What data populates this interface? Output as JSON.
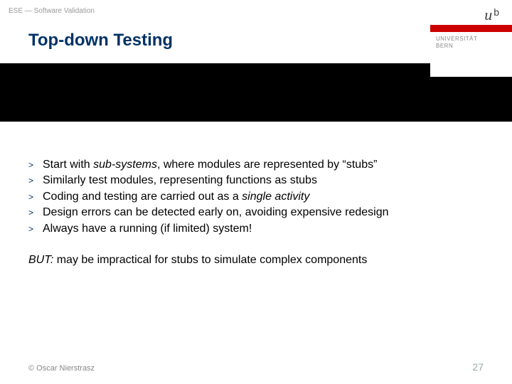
{
  "header": {
    "breadcrumb": "ESE — Software Validation",
    "title": "Top-down Testing"
  },
  "logo": {
    "u": "u",
    "b": "b",
    "uni_line1": "UNIVERSITÄT",
    "uni_line2": "BERN"
  },
  "bullets": [
    {
      "html": "Start with <span class='emph'>sub-systems</span>, where modules are represented by “stubs”"
    },
    {
      "html": "Similarly test modules, representing functions as stubs"
    },
    {
      "html": "Coding and testing are carried out as a <span class='emph'>single activity</span>"
    },
    {
      "html": "Design errors can be detected early on, avoiding expensive redesign"
    },
    {
      "html": "Always have a running (if limited) system!"
    }
  ],
  "note": {
    "prefix_html": "<span class='emph'>BUT:</span>",
    "text": " may be impractical for stubs to simulate complex components"
  },
  "footer": {
    "copyright": "© Oscar Nierstrasz",
    "page": "27"
  },
  "gt": ">"
}
